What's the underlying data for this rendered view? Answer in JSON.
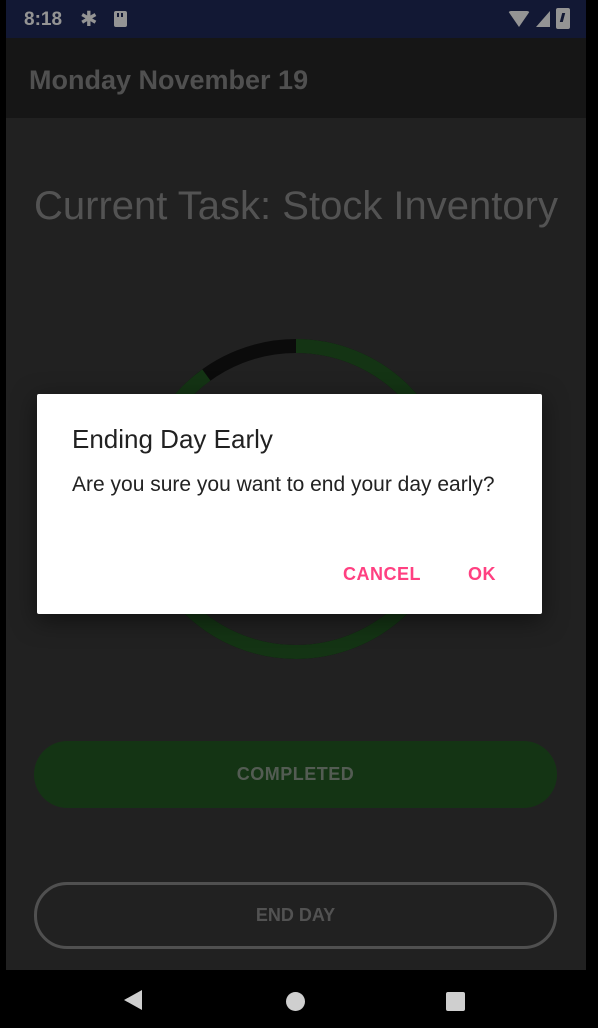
{
  "status_bar": {
    "time": "8:18",
    "icons": [
      "gear-icon",
      "sd-card-icon",
      "wifi-icon",
      "cell-signal-icon",
      "battery-charging-icon"
    ]
  },
  "app_bar": {
    "title": "Monday November 19"
  },
  "main": {
    "current_task": "Current Task: Stock Inventory",
    "progress_ring": {
      "completed_fraction": 0.9,
      "colors": {
        "done": "#245a23",
        "remaining": "#141414"
      }
    },
    "completed_button": "COMPLETED",
    "end_day_button": "END DAY"
  },
  "dialog": {
    "title": "Ending Day Early",
    "message": "Are you sure you want to end your day early?",
    "cancel": "CANCEL",
    "ok": "OK"
  },
  "colors": {
    "status_bar": "#1f2a5a",
    "accent": "#ff4081",
    "primary_green": "#245a23"
  },
  "nav_bar": {
    "icons": [
      "back-icon",
      "home-icon",
      "recents-icon"
    ]
  }
}
